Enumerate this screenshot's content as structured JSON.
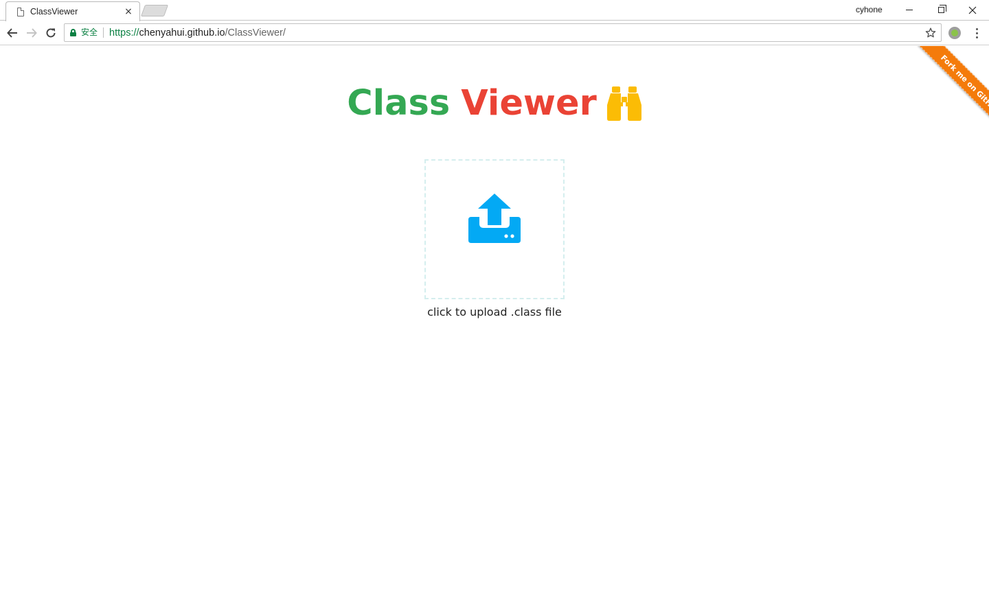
{
  "browser": {
    "tab": {
      "title": "ClassViewer",
      "close_glyph": "×"
    },
    "profile_name": "cyhone",
    "address_bar": {
      "secure_label": "安全",
      "url_scheme": "https://",
      "url_host": "chenyahui.github.io",
      "url_path": "/ClassViewer/"
    },
    "icons": {
      "tab_page": "page-icon",
      "back": "arrow-left-icon",
      "forward": "arrow-right-icon",
      "reload": "reload-icon",
      "lock": "lock-icon",
      "bookmark": "star-icon",
      "extension": "extension-icon",
      "menu": "kebab-menu-icon"
    }
  },
  "page": {
    "ribbon_text": "Fork me on GitHub",
    "title_part1": "Class",
    "title_part2": "Viewer",
    "upload_caption": "click to upload .class file",
    "icons": {
      "title": "binoculars-icon",
      "upload": "upload-icon"
    },
    "colors": {
      "title_part1": "#34a853",
      "title_part2": "#ea4335",
      "binoculars": "#fbbc05",
      "upload_icon": "#03a9f4",
      "ribbon": "#f47b0b",
      "upload_border": "#d4eeee"
    }
  }
}
